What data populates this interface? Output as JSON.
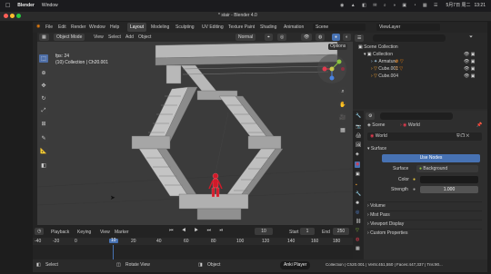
{
  "menubar": {
    "app": "Blender",
    "window": "Window",
    "date": "5月7日 周二",
    "time": "13:21"
  },
  "title": "* stair - Blender 4.0",
  "topbar": {
    "menus": [
      "File",
      "Edit",
      "Render",
      "Window",
      "Help"
    ],
    "workspaces": [
      "Layout",
      "Modeling",
      "Sculpting",
      "UV Editing",
      "Texture Paint",
      "Shading",
      "Animation"
    ],
    "scene": "Scene",
    "view_layer": "ViewLayer"
  },
  "viewport_header": {
    "mode": "Object Mode",
    "menus": [
      "View",
      "Select",
      "Add",
      "Object"
    ],
    "transform": "Normal",
    "options": "Options"
  },
  "overlay": {
    "fps": "fps: 24",
    "object_info": "(10) Collection | Ch20.001"
  },
  "timeline": {
    "menus": [
      "Playback",
      "Keying",
      "View",
      "Marker"
    ],
    "current_frame": "10",
    "start_label": "Start",
    "start": "1",
    "end_label": "End",
    "end": "250",
    "ruler": [
      "-40",
      "-20",
      "0",
      "10",
      "20",
      "40",
      "60",
      "80",
      "100",
      "120",
      "140",
      "160",
      "180",
      "200",
      "220",
      "240",
      "260"
    ]
  },
  "statusbar": {
    "select": "Select",
    "rotate": "Rotate View",
    "object": "Object",
    "app_player": "Anki Player",
    "stats": "Collection | Ch20.001 | Verts:451,550 | Faces:447,337 | Tris:90..."
  },
  "outliner": {
    "items": [
      {
        "label": "Scene Collection",
        "indent": 0
      },
      {
        "label": "Collection",
        "indent": 1
      },
      {
        "label": "Armature",
        "indent": 2
      },
      {
        "label": "Cube.001",
        "indent": 2
      },
      {
        "label": "Cube.004",
        "indent": 2
      }
    ]
  },
  "properties": {
    "breadcrumb_scene": "Scene",
    "breadcrumb_world": "World",
    "world_name": "World",
    "surface_panel": "Surface",
    "use_nodes": "Use Nodes",
    "surface_label": "Surface",
    "surface_value": "Background",
    "color_label": "Color",
    "strength_label": "Strength",
    "strength_value": "1.000",
    "panels": [
      "Volume",
      "Mist Pass",
      "Viewport Display",
      "Custom Properties"
    ]
  },
  "colors": {
    "accent": "#4772b3",
    "active_tab": "#3d3d3d",
    "selected_row": "#334d80"
  }
}
